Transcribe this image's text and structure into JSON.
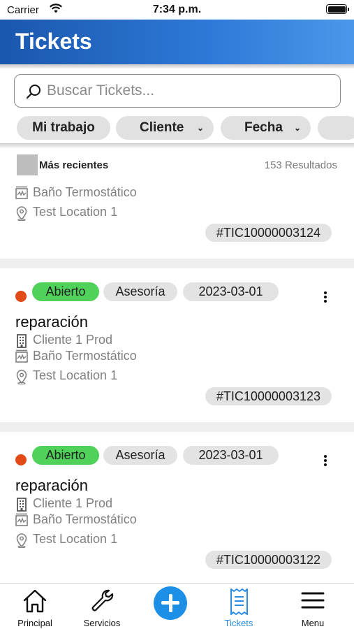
{
  "status_bar": {
    "carrier": "Carrier",
    "time": "7:34 p.m."
  },
  "header": {
    "title": "Tickets"
  },
  "search": {
    "placeholder": "Buscar Tickets...",
    "value": ""
  },
  "filters": [
    {
      "label": "Mi trabajo"
    },
    {
      "label": "Cliente"
    },
    {
      "label": "Fecha"
    }
  ],
  "results": {
    "sort_label": "Más recientes",
    "count": "153 Resultados"
  },
  "tickets": [
    {
      "asset": "Baño Termostático",
      "location": "Test Location 1",
      "id": "#TIC10000003124"
    },
    {
      "status": "Abierto",
      "type": "Asesoría",
      "date": "2023-03-01",
      "title": "reparación",
      "client": "Cliente 1 Prod",
      "asset": "Baño Termostático",
      "location": "Test Location 1",
      "id": "#TIC10000003123"
    },
    {
      "status": "Abierto",
      "type": "Asesoría",
      "date": "2023-03-01",
      "title": "reparación",
      "client": "Cliente 1 Prod",
      "asset": "Baño Termostático",
      "location": "Test Location 1",
      "id": "#TIC10000003122"
    }
  ],
  "nav": [
    {
      "label": "Principal",
      "icon": "home-icon"
    },
    {
      "label": "Servicios",
      "icon": "wrench-icon"
    },
    {
      "label": "",
      "icon": "add-icon"
    },
    {
      "label": "Tickets",
      "icon": "receipt-icon",
      "active": true
    },
    {
      "label": "Menu",
      "icon": "menu-icon"
    }
  ],
  "colors": {
    "header_start": "#1a57ae",
    "header_end": "#4a97ea",
    "status_open": "#4fd15a",
    "status_dot": "#e24a17",
    "accent": "#1e8fe6"
  }
}
